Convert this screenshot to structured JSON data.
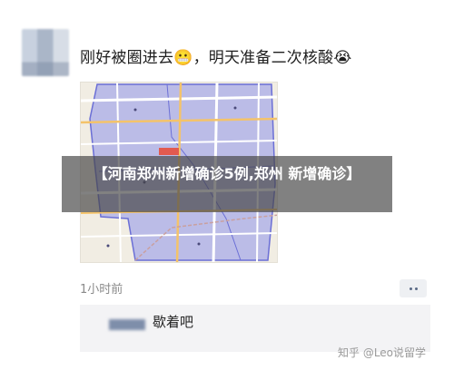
{
  "post": {
    "text": "刚好被圈进去😬，明天准备二次核酸😭",
    "time": "1小时前"
  },
  "overlay": {
    "caption": "【河南郑州新增确诊5例,郑州 新增确诊】"
  },
  "comment": {
    "text": "歇着吧"
  },
  "watermark": {
    "text": "知乎 @Leo说留学"
  },
  "colors": {
    "map_bg": "#f1ede3",
    "highlight_area": "#9fa3ea",
    "road": "#f4c36a",
    "outline": "#6b6fd6"
  }
}
